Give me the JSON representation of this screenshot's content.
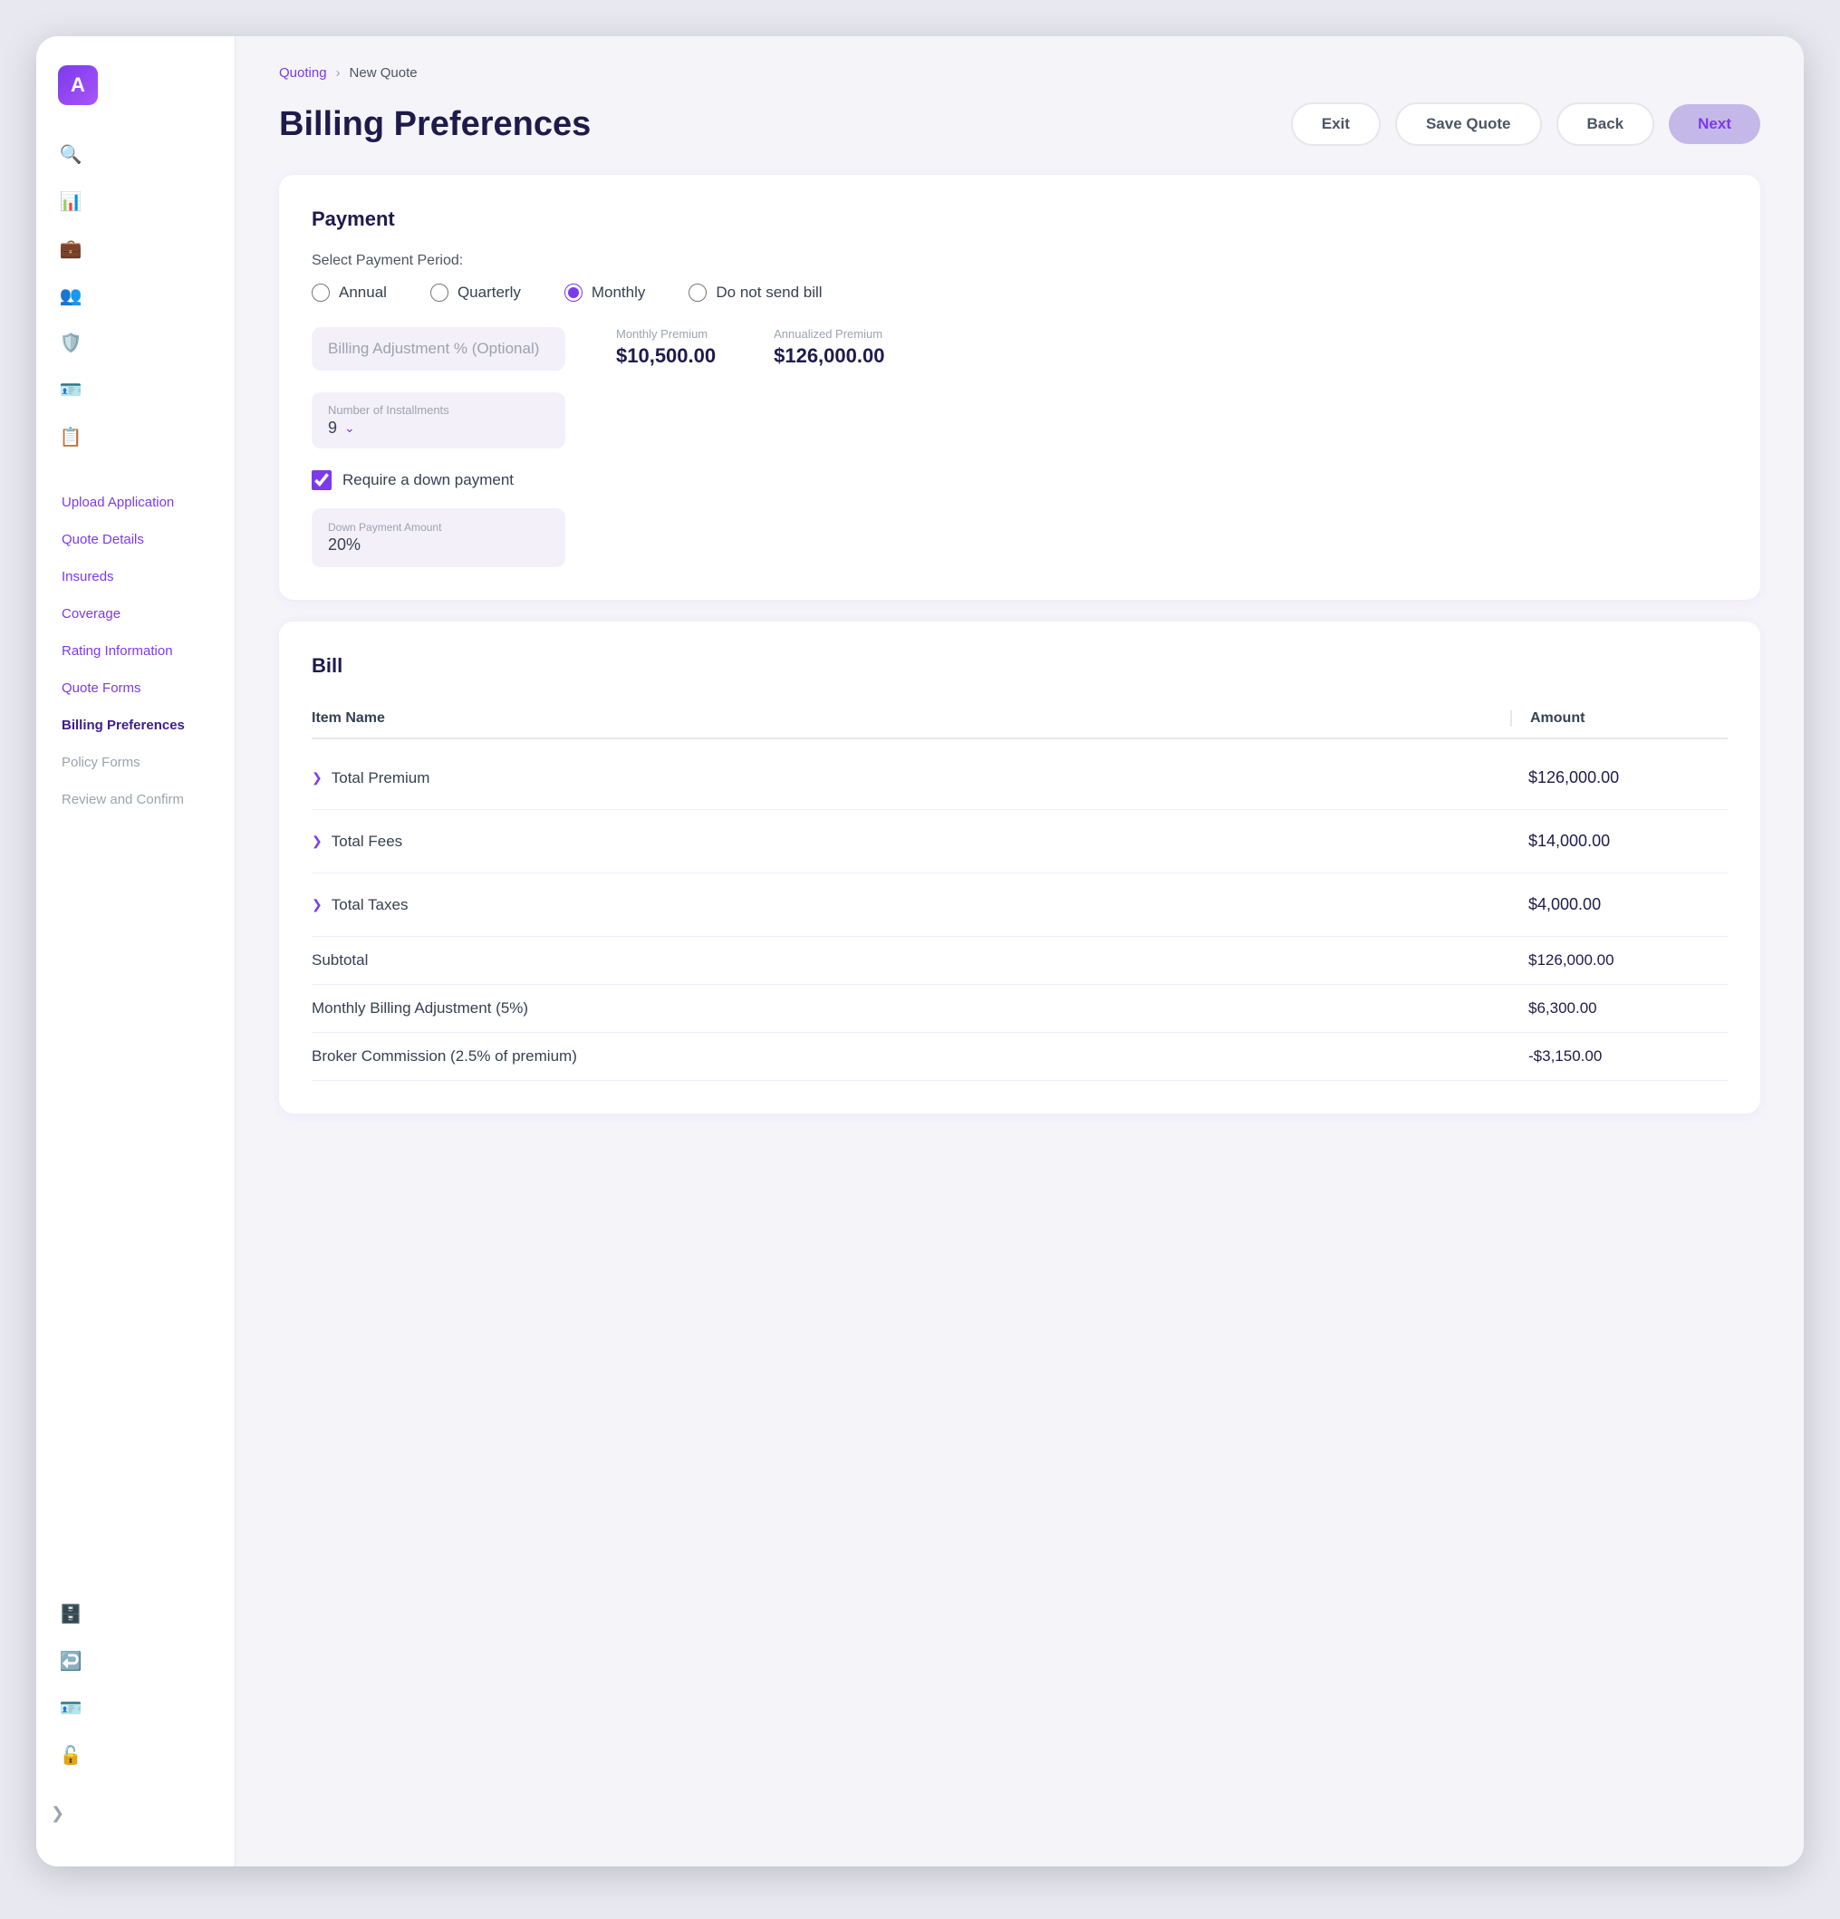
{
  "breadcrumb": {
    "parent": "Quoting",
    "separator": "›",
    "current": "New Quote"
  },
  "page": {
    "title": "Billing Preferences"
  },
  "actions": {
    "exit": "Exit",
    "save_quote": "Save Quote",
    "back": "Back",
    "next": "Next"
  },
  "sidebar": {
    "logo_text": "A",
    "nav_items": [
      {
        "id": "upload-application",
        "label": "Upload Application",
        "state": "normal"
      },
      {
        "id": "quote-details",
        "label": "Quote Details",
        "state": "normal"
      },
      {
        "id": "insureds",
        "label": "Insureds",
        "state": "normal"
      },
      {
        "id": "coverage",
        "label": "Coverage",
        "state": "normal"
      },
      {
        "id": "rating-information",
        "label": "Rating Information",
        "state": "normal"
      },
      {
        "id": "quote-forms",
        "label": "Quote Forms",
        "state": "normal"
      },
      {
        "id": "billing-preferences",
        "label": "Billing Preferences",
        "state": "active"
      },
      {
        "id": "policy-forms",
        "label": "Policy Forms",
        "state": "muted"
      },
      {
        "id": "review-and-confirm",
        "label": "Review and Confirm",
        "state": "muted"
      }
    ]
  },
  "payment_section": {
    "title": "Payment",
    "select_period_label": "Select Payment Period:",
    "options": [
      {
        "id": "annual",
        "label": "Annual",
        "checked": false
      },
      {
        "id": "quarterly",
        "label": "Quarterly",
        "checked": false
      },
      {
        "id": "monthly",
        "label": "Monthly",
        "checked": true
      },
      {
        "id": "do-not-send-bill",
        "label": "Do not send bill",
        "checked": false
      }
    ],
    "billing_adjustment_placeholder": "Billing Adjustment % (Optional)",
    "monthly_premium_label": "Monthly Premium",
    "monthly_premium_value": "$10,500.00",
    "annualized_premium_label": "Annualized Premium",
    "annualized_premium_value": "$126,000.00",
    "number_of_installments_label": "Number of Installments",
    "number_of_installments_value": "9",
    "require_down_payment_label": "Require a down payment",
    "require_down_payment_checked": true,
    "down_payment_label": "Down Payment Amount",
    "down_payment_value": "20%"
  },
  "bill_section": {
    "title": "Bill",
    "col_name": "Item Name",
    "col_amount": "Amount",
    "expandable_rows": [
      {
        "id": "total-premium",
        "name": "Total Premium",
        "amount": "$126,000.00"
      },
      {
        "id": "total-fees",
        "name": "Total Fees",
        "amount": "$14,000.00"
      },
      {
        "id": "total-taxes",
        "name": "Total Taxes",
        "amount": "$4,000.00"
      }
    ],
    "plain_rows": [
      {
        "id": "subtotal",
        "name": "Subtotal",
        "amounts": [
          "$126,000.00"
        ]
      },
      {
        "id": "monthly-billing-adjustment",
        "name": "Monthly Billing Adjustment (5%)",
        "amounts": [
          "$6,300.00"
        ]
      },
      {
        "id": "broker-commission",
        "name": "Broker Commission (2.5% of premium)",
        "amounts": [
          "-$3,150.00"
        ]
      }
    ]
  }
}
